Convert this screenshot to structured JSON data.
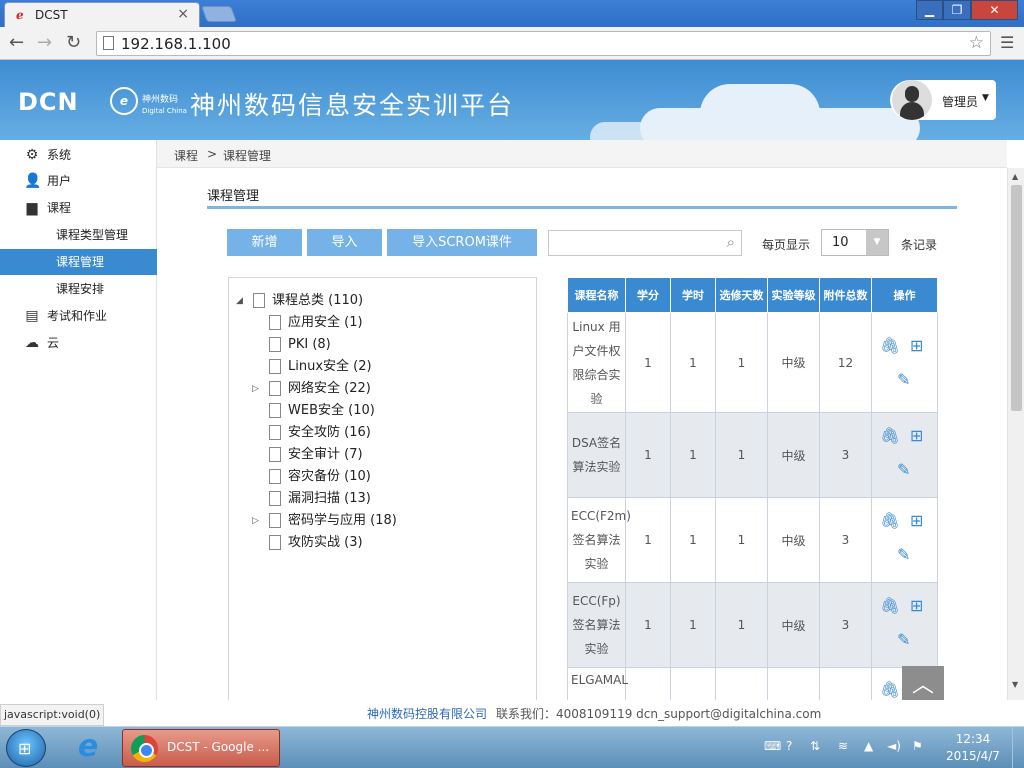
{
  "browser": {
    "tab_title": "DCST",
    "tab_close": "×",
    "url": "192.168.1.100",
    "status_text": "javascript:void(0)"
  },
  "header": {
    "logo_text": "DCN",
    "brand_mark": "e",
    "brand_cn": "神州数码",
    "brand_en": "Digital China",
    "site_title": "神州数码信息安全实训平台",
    "user_name": "管理员"
  },
  "sidebar": {
    "items": [
      {
        "label": "系统",
        "icon": "gear-icon"
      },
      {
        "label": "用户",
        "icon": "user-icon"
      },
      {
        "label": "课程",
        "icon": "book-icon"
      },
      {
        "label": "课程类型管理"
      },
      {
        "label": "课程管理"
      },
      {
        "label": "课程安排"
      },
      {
        "label": "考试和作业",
        "icon": "document-icon"
      },
      {
        "label": "云",
        "icon": "cloud-icon"
      }
    ]
  },
  "breadcrumb": {
    "root": "课程",
    "sep": ">",
    "current": "课程管理"
  },
  "main": {
    "title": "课程管理",
    "buttons": {
      "add": "新增",
      "import": "导入",
      "import_scrom": "导入SCROM课件"
    },
    "search_placeholder": "",
    "per_page_label": "每页显示",
    "per_page_value": "10",
    "per_page_suffix": "条记录"
  },
  "tree": {
    "root": "课程总类 (110)",
    "children": [
      "应用安全 (1)",
      "PKI (8)",
      "Linux安全 (2)",
      "网络安全 (22)",
      "WEB安全 (10)",
      "安全攻防 (16)",
      "安全审计 (7)",
      "容灾备份 (10)",
      "漏洞扫描 (13)",
      "密码学与应用 (18)",
      "攻防实战 (3)"
    ]
  },
  "table": {
    "headers": [
      "课程名称",
      "学分",
      "学时",
      "选修天数",
      "实验等级",
      "附件总数",
      "操作"
    ],
    "rows": [
      {
        "name": "Linux 用户文件权限综合实验",
        "credit": "1",
        "hours": "1",
        "days": "1",
        "level": "中级",
        "attachments": "12"
      },
      {
        "name": "DSA签名算法实验",
        "credit": "1",
        "hours": "1",
        "days": "1",
        "level": "中级",
        "attachments": "3"
      },
      {
        "name": "ECC(F2m)签名算法实验",
        "credit": "1",
        "hours": "1",
        "days": "1",
        "level": "中级",
        "attachments": "3"
      },
      {
        "name": "ECC(Fp)签名算法实验",
        "credit": "1",
        "hours": "1",
        "days": "1",
        "level": "中级",
        "attachments": "3"
      },
      {
        "name": "ELGAMAL",
        "credit": "",
        "hours": "",
        "days": "",
        "level": "",
        "attachments": ""
      }
    ]
  },
  "footer": {
    "company": "神州数码控股有限公司",
    "contact": "联系我们：4008109119    dcn_support@digitalchina.com"
  },
  "taskbar": {
    "chrome_label": "DCST - Google ...",
    "time": "12:34",
    "date": "2015/4/7"
  },
  "colors": {
    "accent": "#3a8ad1",
    "button": "#75b2e8",
    "header_bg": "#4d9ad9"
  }
}
